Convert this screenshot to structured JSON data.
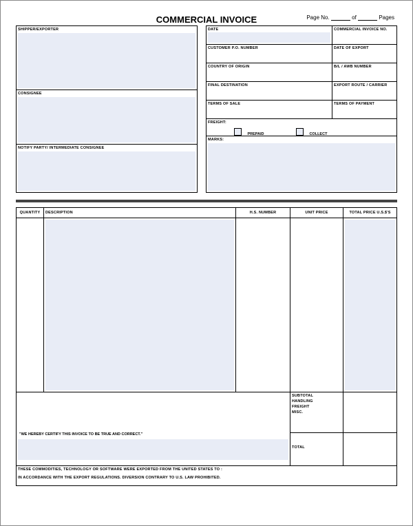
{
  "header": {
    "title": "COMMERCIAL INVOICE",
    "page_no_label": "Page No.",
    "of_label": "of",
    "pages_label": "Pages"
  },
  "left": {
    "shipper_exporter": "SHIPPER/EXPORTER",
    "consignee": "CONSIGNEE",
    "notify_party": "NOTIFY PARTY/ INTERMEDIATE CONSIGNEE"
  },
  "right": {
    "date": "DATE",
    "commercial_invoice_no": "COMMERCIAL INVOICE NO.",
    "customer_po_number": "CUSTOMER P.O. NUMBER",
    "date_of_export": "DATE OF EXPORT",
    "country_of_origin": "COUNTRY OF ORIGIN",
    "bl_awb_number": "B/L / AWB NUMBER",
    "final_destination": "FINAL DESTINATION",
    "export_route_carrier": "EXPORT ROUTE / CARRIER",
    "terms_of_sale": "TERMS OF SALE",
    "terms_of_payment": "TERMS OF PAYMENT",
    "freight": "FREIGHT:",
    "prepaid": "PREPAID",
    "collect": "COLLECT",
    "marks": "MARKS:"
  },
  "table": {
    "quantity": "QUANTITY",
    "description": "DESCRIPTION",
    "hs_number": "H.S. NUMBER",
    "unit_price": "UNIT PRICE",
    "total_price": "TOTAL PRICE U.S.$'S"
  },
  "totals": {
    "subtotal": "SUBTOTAL",
    "handling": "HANDLING",
    "freight": "FREIGHT",
    "misc": "MISC.",
    "total": "TOTAL"
  },
  "footer": {
    "certify": "\"WE HEREBY CERTIFY THIS INVOICE TO BE TRUE AND CORRECT.\"",
    "disclaimer1": "THESE COMMODITIES, TECHNOLOGY OR SOFTWARE WERE EXPORTED FROM THE UNITED STATES TO :",
    "disclaimer2": "IN ACCORDANCE WITH THE EXPORT REGULATIONS.  DIVERSION CONTRARY TO U.S. LAW PROHIBITED."
  }
}
